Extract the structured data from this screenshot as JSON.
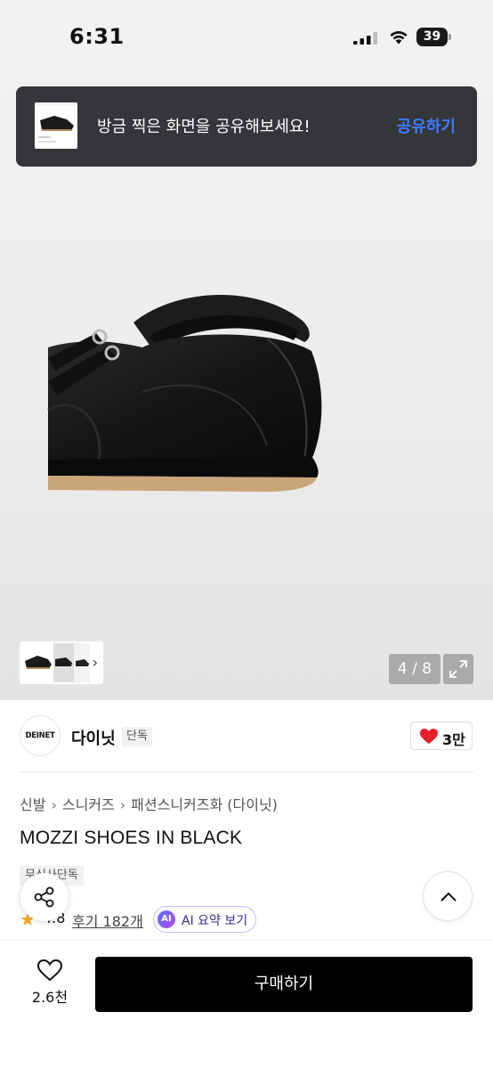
{
  "status_bar": {
    "time": "6:31",
    "battery": "39"
  },
  "toast": {
    "message": "방금 찍은 화면을 공유해보세요!",
    "action": "공유하기"
  },
  "gallery": {
    "counter": "4 / 8"
  },
  "brand": {
    "logo_text": "DEINET",
    "name": "다이닛",
    "badge": "단독",
    "like_count": "3만"
  },
  "breadcrumbs": [
    "신발",
    "스니커즈",
    "패션스니커즈화 (다이닛)"
  ],
  "product": {
    "title": "MOZZI SHOES IN BLACK",
    "tag": "무신사단독",
    "rating": "4.8",
    "reviews": "후기 182개",
    "ai_summary": "AI 요약 보기",
    "ai_badge": "AI"
  },
  "bottom": {
    "wish_count": "2.6천",
    "buy_label": "구매하기"
  },
  "colors": {
    "accent_blue": "#3d7bff",
    "heart_red": "#e8202a",
    "star": "#f5a623"
  }
}
